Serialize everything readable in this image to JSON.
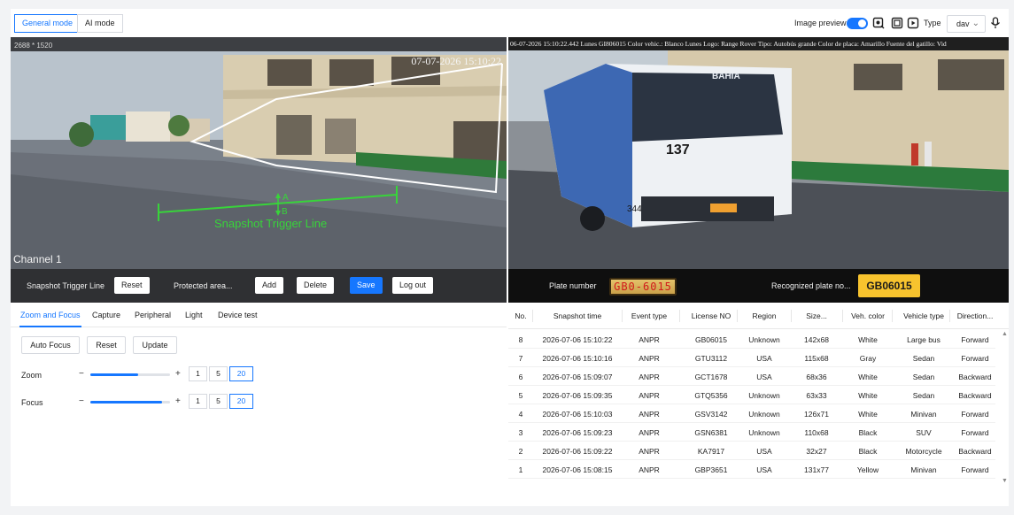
{
  "header": {
    "modes": [
      "General mode",
      "AI mode"
    ],
    "image_preview_label": "Image preview",
    "image_preview_on": true,
    "type_label": "Type",
    "type_value": "dav",
    "accent_color": "#1677ff"
  },
  "left_video": {
    "resolution": "2688 * 1520",
    "osd_time": "07-07-2026 15:10:22",
    "channel": "Channel 1",
    "trigger_label": "Snapshot Trigger Line",
    "marker_a": "A",
    "marker_b": "B"
  },
  "right_video": {
    "info": "06-07-2026 15:10:22.442 Lunes GI806015 Color vehic.: Blanco Lunes Logo: Range Rover Tipo: Autobús grande Color de placa: Amarillo Fuente del gatillo: Vid",
    "bus_route": "BAHIA",
    "bus_number": "137",
    "bus_side_number": "344"
  },
  "left_controls": {
    "trigger_line_label": "Snapshot Trigger Line",
    "reset": "Reset",
    "protected_area_label": "Protected area...",
    "add": "Add",
    "delete": "Delete",
    "save": "Save",
    "logout": "Log out"
  },
  "plate_bar": {
    "plate_number_label": "Plate number",
    "plate_image_text": "GB0-6015",
    "recognized_label": "Recognized plate no...",
    "recognized_value": "GB06015",
    "badge_color": "#f7c32e"
  },
  "tabs": [
    "Zoom and Focus",
    "Capture",
    "Peripheral",
    "Light",
    "Device test"
  ],
  "zoom_focus": {
    "auto_focus": "Auto Focus",
    "reset": "Reset",
    "update": "Update",
    "zoom_label": "Zoom",
    "focus_label": "Focus",
    "zoom_level": 0.6,
    "focus_level": 0.9,
    "steps": [
      "1",
      "5",
      "20"
    ],
    "selected_step": "20",
    "minus": "−",
    "plus": "+"
  },
  "table": {
    "columns": [
      "No.",
      "Snapshot time",
      "Event type",
      "License NO",
      "Region",
      "Size...",
      "Veh. color",
      "Vehicle type",
      "Direction..."
    ],
    "rows": [
      [
        "8",
        "2026-07-06 15:10:22",
        "ANPR",
        "GB06015",
        "Unknown",
        "142x68",
        "White",
        "Large bus",
        "Forward"
      ],
      [
        "7",
        "2026-07-06 15:10:16",
        "ANPR",
        "GTU3112",
        "USA",
        "115x68",
        "Gray",
        "Sedan",
        "Forward"
      ],
      [
        "6",
        "2026-07-06 15:09:07",
        "ANPR",
        "GCT1678",
        "USA",
        "68x36",
        "White",
        "Sedan",
        "Backward"
      ],
      [
        "5",
        "2026-07-06 15:09:35",
        "ANPR",
        "GTQ5356",
        "Unknown",
        "63x33",
        "White",
        "Sedan",
        "Backward"
      ],
      [
        "4",
        "2026-07-06 15:10:03",
        "ANPR",
        "GSV3142",
        "Unknown",
        "126x71",
        "White",
        "Minivan",
        "Forward"
      ],
      [
        "3",
        "2026-07-06 15:09:23",
        "ANPR",
        "GSN6381",
        "Unknown",
        "110x68",
        "Black",
        "SUV",
        "Forward"
      ],
      [
        "2",
        "2026-07-06 15:09:22",
        "ANPR",
        "KA7917",
        "USA",
        "32x27",
        "Black",
        "Motorcycle",
        "Backward"
      ],
      [
        "1",
        "2026-07-06 15:08:15",
        "ANPR",
        "GBP3651",
        "USA",
        "131x77",
        "Yellow",
        "Minivan",
        "Forward"
      ]
    ]
  }
}
